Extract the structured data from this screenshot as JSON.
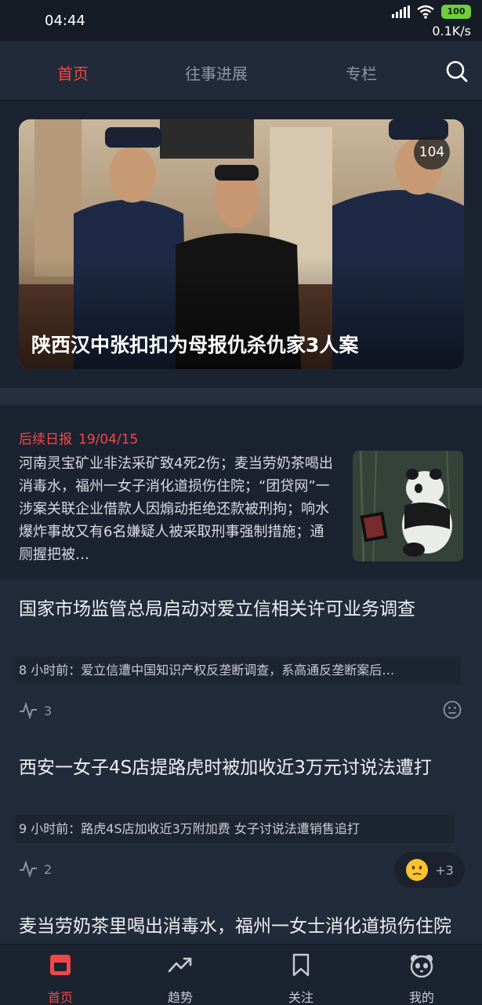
{
  "status": {
    "time": "04:44",
    "battery": "100",
    "net_speed": "0.1K/s"
  },
  "top_tabs": [
    {
      "label": "首页",
      "active": true
    },
    {
      "label": "往事进展",
      "active": false
    },
    {
      "label": "专栏",
      "active": false
    }
  ],
  "hero": {
    "title": "陕西汉中张扣扣为母报仇杀仇家3人案",
    "badge": "104"
  },
  "daily": {
    "label": "后续日报",
    "date": "19/04/15",
    "text": "河南灵宝矿业非法采矿致4死2伤；麦当劳奶茶喝出消毒水，福州一女子消化道损伤住院；“团贷网”一涉案关联企业借款人因煽动拒绝还款被刑拘；响水爆炸事故又有6名嫌疑人被采取刑事强制措施；通厕握把被…"
  },
  "feed": [
    {
      "title": "国家市场监管总局启动对爱立信相关许可业务调查",
      "time": "8 小时前：",
      "summary": "爱立信遭中国知识产权反垄断调查，系高通反垄断案后…",
      "count": "3"
    },
    {
      "title": "西安一女子4S店提路虎时被加收近3万元讨说法遭打",
      "time": "9 小时前：",
      "summary": "路虎4S店加收近3万附加费 女子讨说法遭销售追打",
      "count": "2",
      "reaction_extra": "+3"
    },
    {
      "title": "麦当劳奶茶里喝出消毒水，福州一女士消化道损伤住院"
    }
  ],
  "bottom_nav": [
    {
      "label": "首页",
      "icon": "home-icon",
      "active": true
    },
    {
      "label": "趋势",
      "icon": "trend-icon",
      "active": false
    },
    {
      "label": "关注",
      "icon": "bookmark-icon",
      "active": false
    },
    {
      "label": "我的",
      "icon": "panda-icon",
      "active": false
    }
  ],
  "colors": {
    "accent": "#f04848",
    "background": "#1c2330",
    "card": "#222b39"
  }
}
